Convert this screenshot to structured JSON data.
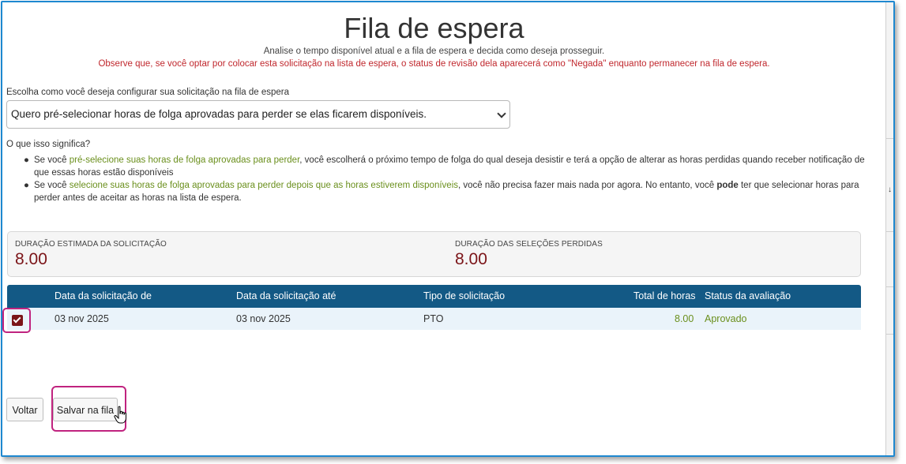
{
  "header": {
    "title": "Fila de espera",
    "subtitle": "Analise o tempo disponível atual e a fila de espera e decida como deseja prosseguir.",
    "warning": "Observe que, se você optar por colocar esta solicitação na lista de espera, o status de revisão dela aparecerá como \"Negada\" enquanto permanecer na fila de espera."
  },
  "config": {
    "label": "Escolha como você deseja configurar sua solicitação na fila de espera",
    "selected_option": "Quero pré-selecionar horas de folga aprovadas para perder se elas ficarem disponíveis."
  },
  "meaning": {
    "heading": "O que isso significa?",
    "bullet1": {
      "prefix": "Se você ",
      "highlight": "pré-selecione suas horas de folga aprovadas para perder",
      "suffix": ", você escolherá o próximo tempo de folga do qual deseja desistir e terá a opção de alterar as horas perdidas quando receber notificação de que essas horas estão disponíveis"
    },
    "bullet2": {
      "prefix": "Se você ",
      "highlight": "selecione suas horas de folga aprovadas para perder depois que as horas estiverem disponíveis",
      "mid": ", você não precisa fazer mais nada por agora. No entanto, você ",
      "bold": "pode",
      "suffix": " ter que selecionar horas para perder antes de aceitar as horas na lista de espera."
    }
  },
  "summary": {
    "estimated_label": "DURAÇÃO ESTIMADA DA SOLICITAÇÃO",
    "estimated_value": "8.00",
    "lost_label": "DURAÇÃO DAS SELEÇÕES PERDIDAS",
    "lost_value": "8.00"
  },
  "table": {
    "columns": {
      "from": "Data da solicitação de",
      "to": "Data da solicitação até",
      "type": "Tipo de solicitação",
      "hours": "Total de horas",
      "status": "Status da avaliação"
    },
    "rows": [
      {
        "checked": true,
        "from": "03 nov 2025",
        "to": "03 nov 2025",
        "type": "PTO",
        "hours": "8.00",
        "status": "Aprovado"
      }
    ]
  },
  "buttons": {
    "back": "Voltar",
    "save": "Salvar na fila"
  },
  "colors": {
    "header_bg": "#135985",
    "accent_red": "#7b1418",
    "warning": "#c0272d",
    "highlight_green": "#6a8f1c",
    "callout": "#c0237f"
  }
}
